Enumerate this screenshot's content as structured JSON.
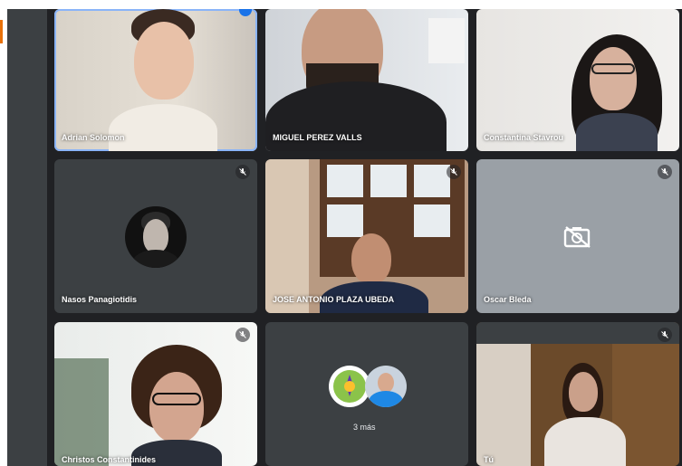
{
  "participants": [
    {
      "name": "Adrian Solomon",
      "muted": false,
      "speaking": true
    },
    {
      "name": "MIGUEL PEREZ VALLS",
      "muted": false
    },
    {
      "name": "Constantina Stavrou",
      "muted": false
    },
    {
      "name": "Nasos Panagiotidis",
      "muted": true
    },
    {
      "name": "JOSE ANTONIO PLAZA UBEDA",
      "muted": true
    },
    {
      "name": "Oscar Bleda",
      "muted": true
    },
    {
      "name": "Christos Constantinides",
      "muted": true
    },
    {
      "name": "Tú",
      "muted": true
    }
  ],
  "overflow": {
    "label": "3 más"
  },
  "icons": {
    "mic_off": "mic-off-icon",
    "camera_off": "camera-off-icon"
  },
  "colors": {
    "tile_bg": "#3c4043",
    "page_bg": "#202124",
    "active_outline": "#8ab4f8",
    "accent": "#e8710a"
  }
}
